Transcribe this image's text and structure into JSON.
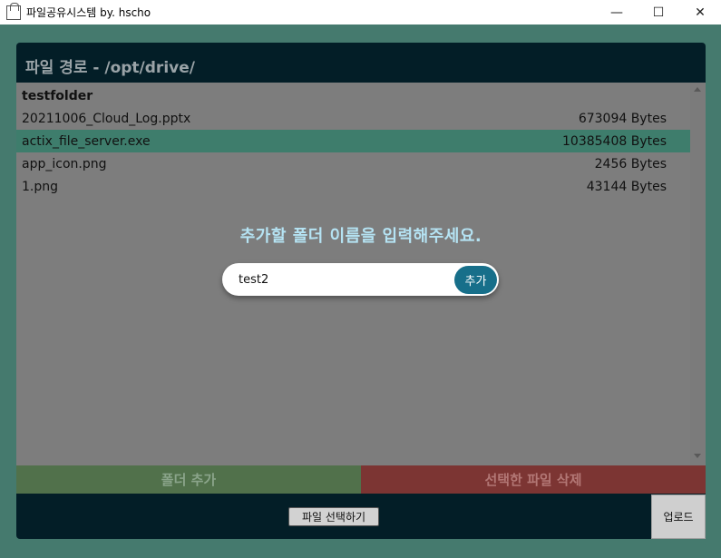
{
  "window": {
    "title": "파일공유시스템 by. hscho",
    "minimize": "—",
    "maximize": "☐",
    "close": "✕"
  },
  "header": {
    "path_title": "파일 경로 - /opt/drive/"
  },
  "files": [
    {
      "name": "testfolder",
      "size": "",
      "type": "folder",
      "selected": false
    },
    {
      "name": "20211006_Cloud_Log.pptx",
      "size": "673094 Bytes",
      "type": "file",
      "selected": false
    },
    {
      "name": "actix_file_server.exe",
      "size": "10385408 Bytes",
      "type": "file",
      "selected": true
    },
    {
      "name": "app_icon.png",
      "size": "2456 Bytes",
      "type": "file",
      "selected": false
    },
    {
      "name": "1.png",
      "size": "43144 Bytes",
      "type": "file",
      "selected": false
    }
  ],
  "modal": {
    "prompt": "추가할 폴더 이름을 입력해주세요.",
    "input_value": "test2",
    "add_label": "추가"
  },
  "actions": {
    "add_folder": "폴더 추가",
    "delete_selected": "선택한 파일 삭제"
  },
  "bottom": {
    "choose_file": "파일 선택하기",
    "upload": "업로드"
  },
  "colors": {
    "background": "#457a6e",
    "panel": "#031e27",
    "list": "#7d7d7d",
    "selected_row": "#3e7d6c",
    "prompt_text": "#b5e3f3",
    "add_button": "#176f8a",
    "add_folder_button": "#51714b",
    "delete_button": "#7c3533"
  }
}
